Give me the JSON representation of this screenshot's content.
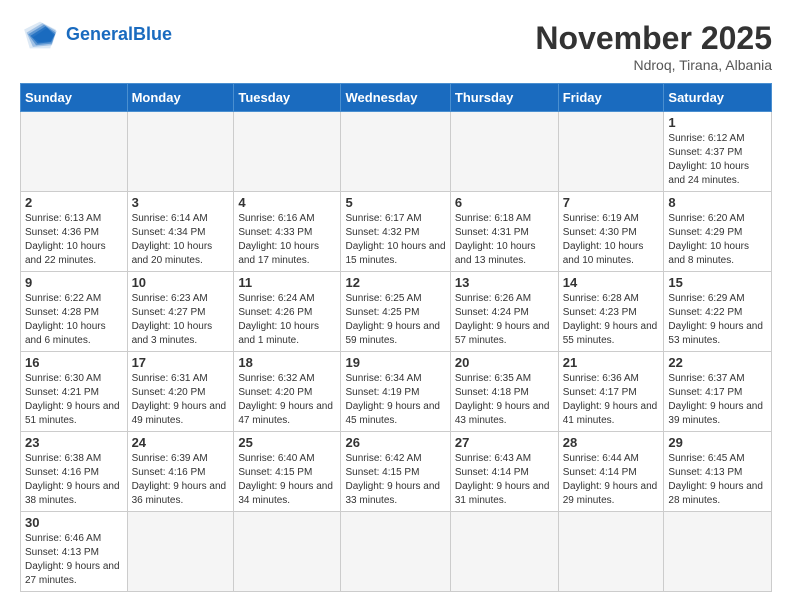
{
  "header": {
    "logo_general": "General",
    "logo_blue": "Blue",
    "month": "November 2025",
    "location": "Ndroq, Tirana, Albania"
  },
  "weekdays": [
    "Sunday",
    "Monday",
    "Tuesday",
    "Wednesday",
    "Thursday",
    "Friday",
    "Saturday"
  ],
  "weeks": [
    [
      {
        "day": "",
        "info": ""
      },
      {
        "day": "",
        "info": ""
      },
      {
        "day": "",
        "info": ""
      },
      {
        "day": "",
        "info": ""
      },
      {
        "day": "",
        "info": ""
      },
      {
        "day": "",
        "info": ""
      },
      {
        "day": "1",
        "info": "Sunrise: 6:12 AM\nSunset: 4:37 PM\nDaylight: 10 hours\nand 24 minutes."
      }
    ],
    [
      {
        "day": "2",
        "info": "Sunrise: 6:13 AM\nSunset: 4:36 PM\nDaylight: 10 hours\nand 22 minutes."
      },
      {
        "day": "3",
        "info": "Sunrise: 6:14 AM\nSunset: 4:34 PM\nDaylight: 10 hours\nand 20 minutes."
      },
      {
        "day": "4",
        "info": "Sunrise: 6:16 AM\nSunset: 4:33 PM\nDaylight: 10 hours\nand 17 minutes."
      },
      {
        "day": "5",
        "info": "Sunrise: 6:17 AM\nSunset: 4:32 PM\nDaylight: 10 hours\nand 15 minutes."
      },
      {
        "day": "6",
        "info": "Sunrise: 6:18 AM\nSunset: 4:31 PM\nDaylight: 10 hours\nand 13 minutes."
      },
      {
        "day": "7",
        "info": "Sunrise: 6:19 AM\nSunset: 4:30 PM\nDaylight: 10 hours\nand 10 minutes."
      },
      {
        "day": "8",
        "info": "Sunrise: 6:20 AM\nSunset: 4:29 PM\nDaylight: 10 hours\nand 8 minutes."
      }
    ],
    [
      {
        "day": "9",
        "info": "Sunrise: 6:22 AM\nSunset: 4:28 PM\nDaylight: 10 hours\nand 6 minutes."
      },
      {
        "day": "10",
        "info": "Sunrise: 6:23 AM\nSunset: 4:27 PM\nDaylight: 10 hours\nand 3 minutes."
      },
      {
        "day": "11",
        "info": "Sunrise: 6:24 AM\nSunset: 4:26 PM\nDaylight: 10 hours\nand 1 minute."
      },
      {
        "day": "12",
        "info": "Sunrise: 6:25 AM\nSunset: 4:25 PM\nDaylight: 9 hours\nand 59 minutes."
      },
      {
        "day": "13",
        "info": "Sunrise: 6:26 AM\nSunset: 4:24 PM\nDaylight: 9 hours\nand 57 minutes."
      },
      {
        "day": "14",
        "info": "Sunrise: 6:28 AM\nSunset: 4:23 PM\nDaylight: 9 hours\nand 55 minutes."
      },
      {
        "day": "15",
        "info": "Sunrise: 6:29 AM\nSunset: 4:22 PM\nDaylight: 9 hours\nand 53 minutes."
      }
    ],
    [
      {
        "day": "16",
        "info": "Sunrise: 6:30 AM\nSunset: 4:21 PM\nDaylight: 9 hours\nand 51 minutes."
      },
      {
        "day": "17",
        "info": "Sunrise: 6:31 AM\nSunset: 4:20 PM\nDaylight: 9 hours\nand 49 minutes."
      },
      {
        "day": "18",
        "info": "Sunrise: 6:32 AM\nSunset: 4:20 PM\nDaylight: 9 hours\nand 47 minutes."
      },
      {
        "day": "19",
        "info": "Sunrise: 6:34 AM\nSunset: 4:19 PM\nDaylight: 9 hours\nand 45 minutes."
      },
      {
        "day": "20",
        "info": "Sunrise: 6:35 AM\nSunset: 4:18 PM\nDaylight: 9 hours\nand 43 minutes."
      },
      {
        "day": "21",
        "info": "Sunrise: 6:36 AM\nSunset: 4:17 PM\nDaylight: 9 hours\nand 41 minutes."
      },
      {
        "day": "22",
        "info": "Sunrise: 6:37 AM\nSunset: 4:17 PM\nDaylight: 9 hours\nand 39 minutes."
      }
    ],
    [
      {
        "day": "23",
        "info": "Sunrise: 6:38 AM\nSunset: 4:16 PM\nDaylight: 9 hours\nand 38 minutes."
      },
      {
        "day": "24",
        "info": "Sunrise: 6:39 AM\nSunset: 4:16 PM\nDaylight: 9 hours\nand 36 minutes."
      },
      {
        "day": "25",
        "info": "Sunrise: 6:40 AM\nSunset: 4:15 PM\nDaylight: 9 hours\nand 34 minutes."
      },
      {
        "day": "26",
        "info": "Sunrise: 6:42 AM\nSunset: 4:15 PM\nDaylight: 9 hours\nand 33 minutes."
      },
      {
        "day": "27",
        "info": "Sunrise: 6:43 AM\nSunset: 4:14 PM\nDaylight: 9 hours\nand 31 minutes."
      },
      {
        "day": "28",
        "info": "Sunrise: 6:44 AM\nSunset: 4:14 PM\nDaylight: 9 hours\nand 29 minutes."
      },
      {
        "day": "29",
        "info": "Sunrise: 6:45 AM\nSunset: 4:13 PM\nDaylight: 9 hours\nand 28 minutes."
      }
    ],
    [
      {
        "day": "30",
        "info": "Sunrise: 6:46 AM\nSunset: 4:13 PM\nDaylight: 9 hours\nand 27 minutes."
      },
      {
        "day": "",
        "info": ""
      },
      {
        "day": "",
        "info": ""
      },
      {
        "day": "",
        "info": ""
      },
      {
        "day": "",
        "info": ""
      },
      {
        "day": "",
        "info": ""
      },
      {
        "day": "",
        "info": ""
      }
    ]
  ]
}
